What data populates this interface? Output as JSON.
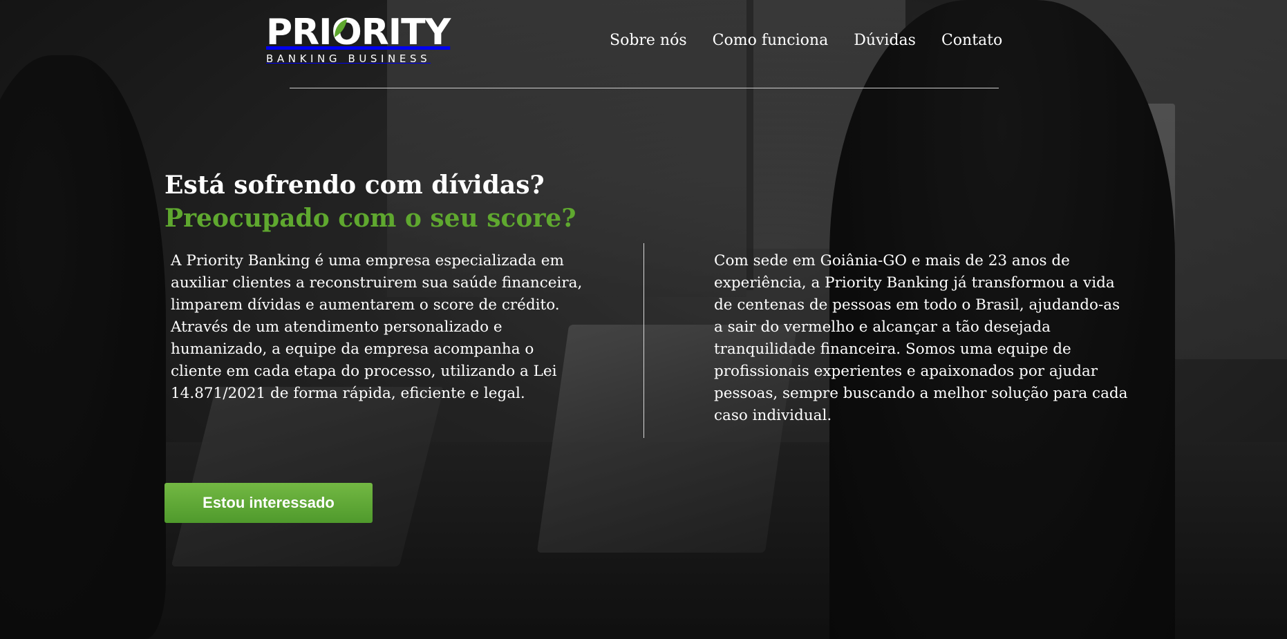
{
  "brand": {
    "name": "PRIORITY",
    "tagline": "BANKING BUSINESS",
    "accent_color": "#5fa82f"
  },
  "nav": {
    "items": [
      {
        "label": "Sobre nós"
      },
      {
        "label": "Como funciona"
      },
      {
        "label": "Dúvidas"
      },
      {
        "label": "Contato"
      }
    ]
  },
  "hero": {
    "headline": "Está sofrendo com dívidas?",
    "subheadline": "Preocupado com o seu score?",
    "left_paragraph": "A Priority Banking é uma empresa especializada em auxiliar clientes a reconstruirem sua saúde financeira, limparem dívidas e aumentarem o score de crédito. Através de um atendimento personalizado e humanizado, a equipe da empresa acompanha o cliente em cada etapa do processo, utilizando a Lei 14.871/2021 de forma rápida, eficiente e legal.",
    "right_paragraph": "Com sede em Goiânia-GO e mais de 23 anos de experiência, a Priority Banking já transformou a vida de centenas de pessoas em todo o Brasil, ajudando-as a sair do vermelho e alcançar a tão desejada tranquilidade financeira. Somos uma equipe de profissionais experientes e apaixonados por ajudar pessoas, sempre buscando a melhor solução para cada caso individual.",
    "cta_label": "Estou interessado"
  }
}
